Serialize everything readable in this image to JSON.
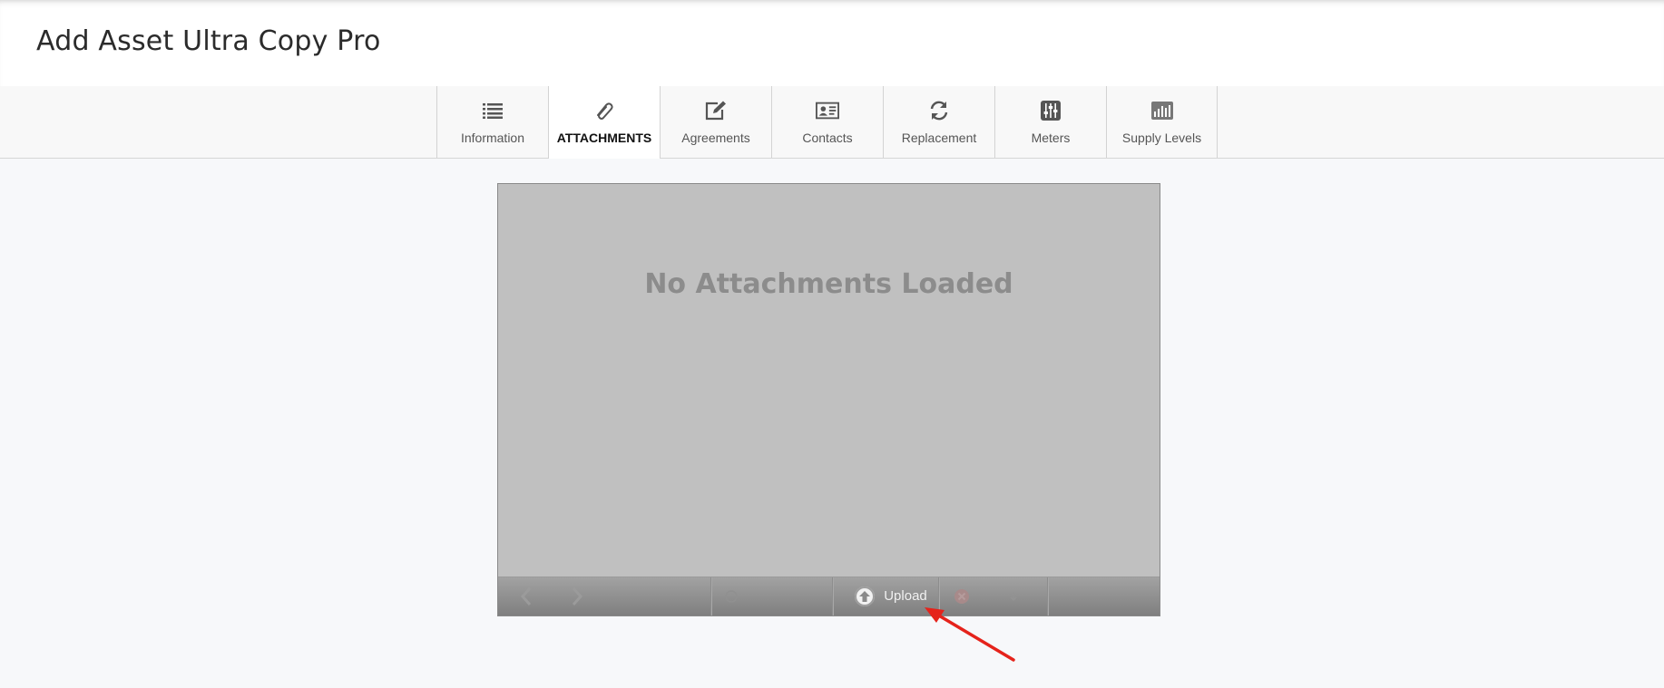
{
  "header": {
    "title": "Add Asset Ultra Copy Pro"
  },
  "tabs": [
    {
      "label": "Information",
      "icon": "list-icon",
      "active": false
    },
    {
      "label": "ATTACHMENTS",
      "icon": "paperclip-icon",
      "active": true
    },
    {
      "label": "Agreements",
      "icon": "edit-icon",
      "active": false
    },
    {
      "label": "Contacts",
      "icon": "contact-card-icon",
      "active": false
    },
    {
      "label": "Replacement",
      "icon": "refresh-icon",
      "active": false
    },
    {
      "label": "Meters",
      "icon": "sliders-icon",
      "active": false
    },
    {
      "label": "Supply Levels",
      "icon": "bar-chart-icon",
      "active": false
    }
  ],
  "viewer": {
    "empty_message": "No Attachments Loaded",
    "toolbar": {
      "upload_label": "Upload",
      "upload_icon": "upload-icon",
      "prev_icon": "chevron-left-icon",
      "next_icon": "chevron-right-icon",
      "rotate_icon": "rotate-icon",
      "delete_icon": "delete-icon",
      "download_icon": "download-icon"
    }
  },
  "annotation": {
    "arrow_color": "#e5231b"
  },
  "colors": {
    "active_tab_text": "#111111",
    "tab_text": "#555555",
    "viewer_bg": "#c0c0c0",
    "viewer_toolbar": "#8f8f8f"
  }
}
